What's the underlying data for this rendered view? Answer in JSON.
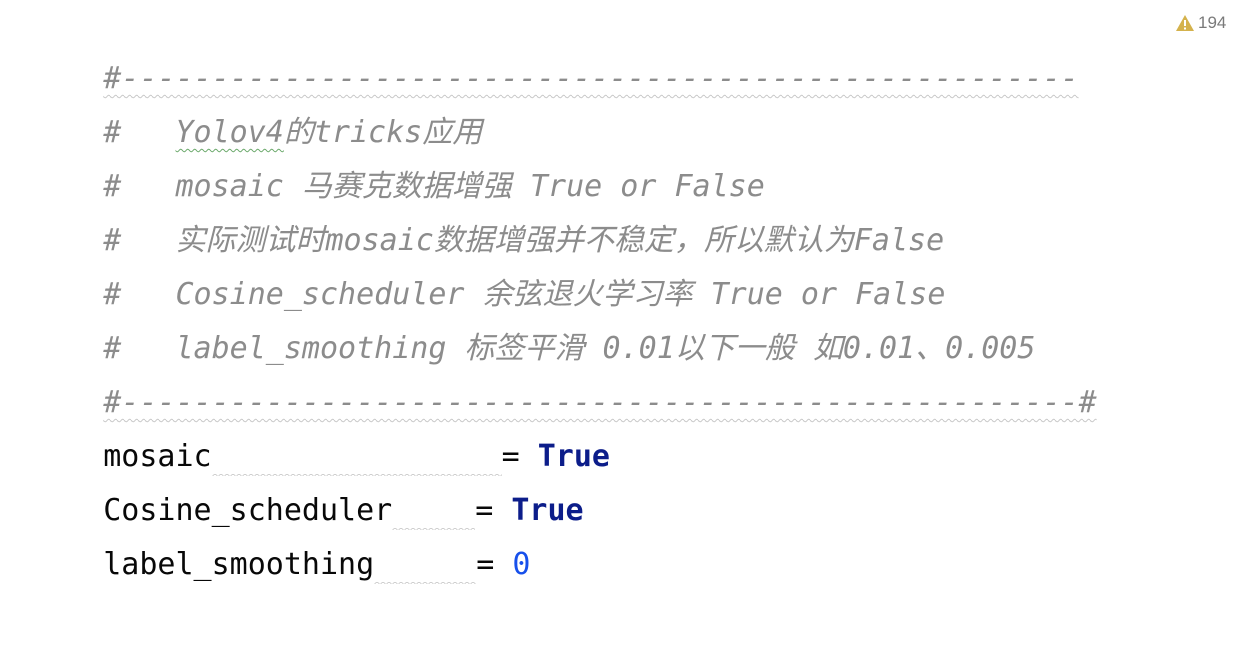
{
  "warning": {
    "icon": "warning-triangle-icon",
    "count": "194",
    "color": "#d4b24c"
  },
  "comment_block": {
    "top_rule": "#-----------------------------------------------------",
    "lines": [
      {
        "hash": "#",
        "text": "Yolov4的tricks应用",
        "squiggle_word": "Yolov4",
        "rest": "的tricks应用"
      },
      {
        "hash": "#",
        "text": "mosaic 马赛克数据增强 True or False"
      },
      {
        "hash": "#",
        "text": "实际测试时mosaic数据增强并不稳定，所以默认为False"
      },
      {
        "hash": "#",
        "text": "Cosine_scheduler 余弦退火学习率 True or False"
      },
      {
        "hash": "#",
        "text": "label_smoothing 标签平滑 0.01以下一般 如0.01、0.005"
      }
    ],
    "bottom_rule": "#-----------------------------------------------------#"
  },
  "assignments": [
    {
      "name": "mosaic",
      "op": "=",
      "value": "True",
      "value_kind": "keyword"
    },
    {
      "name": "Cosine_scheduler",
      "op": "=",
      "value": "True",
      "value_kind": "keyword"
    },
    {
      "name": "label_smoothing",
      "op": "=",
      "value": "0",
      "value_kind": "number"
    }
  ],
  "colors": {
    "comment": "#8c8c8c",
    "keyword": "#0c1d8a",
    "number": "#1750eb",
    "code": "#080808"
  }
}
